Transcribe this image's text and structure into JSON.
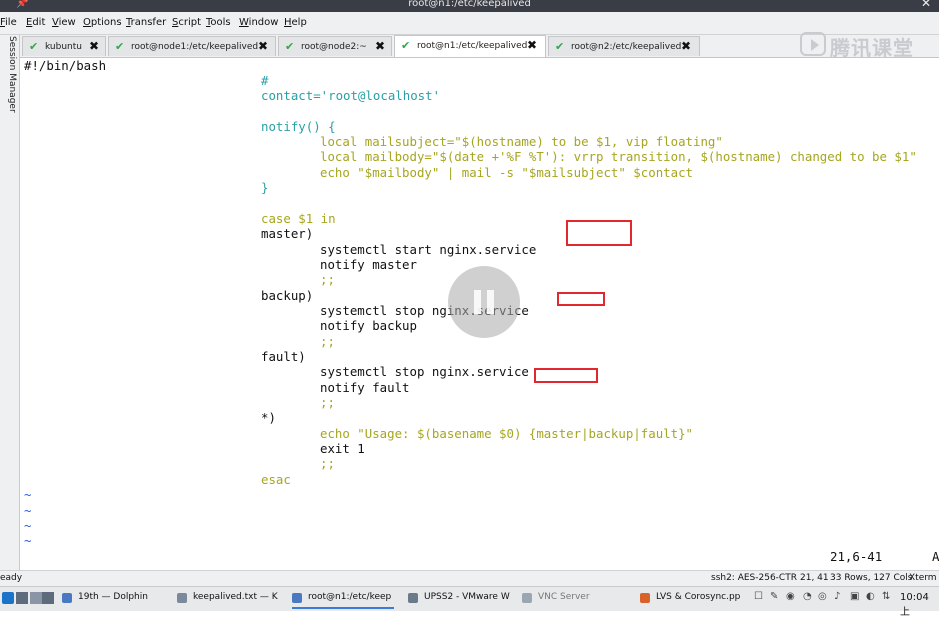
{
  "window": {
    "title": "root@n1:/etc/keepalived"
  },
  "menu": [
    {
      "label": "File",
      "acc": "F",
      "rest": "ile"
    },
    {
      "label": "Edit",
      "acc": "E",
      "rest": "dit"
    },
    {
      "label": "View",
      "acc": "V",
      "rest": "iew"
    },
    {
      "label": "Options",
      "acc": "O",
      "rest": "ptions"
    },
    {
      "label": "Transfer",
      "acc": "T",
      "rest": "ransfer"
    },
    {
      "label": "Script",
      "acc": "S",
      "rest": "cript"
    },
    {
      "label": "Tools",
      "acc": "T",
      "rest": "ools"
    },
    {
      "label": "Window",
      "acc": "W",
      "rest": "indow"
    },
    {
      "label": "Help",
      "acc": "H",
      "rest": "elp"
    }
  ],
  "side_panel": {
    "label": "Session Manager"
  },
  "tabs": [
    {
      "label": "kubuntu"
    },
    {
      "label": "root@node1:/etc/keepalived"
    },
    {
      "label": "root@node2:~"
    },
    {
      "label": "root@n1:/etc/keepalived"
    },
    {
      "label": "root@n2:/etc/keepalived"
    }
  ],
  "watermark": "腾讯课堂",
  "editor": {
    "lines": [
      "#!/bin/bash",
      "#",
      "contact='root@localhost'",
      "notify() {",
      "local mailsubject=\"$(hostname) to be $1, vip floating\"",
      "local mailbody=\"$(date +'%F %T'): vrrp transition, $(hostname) changed to be $1\"",
      "echo \"$mailbody\" | mail -s \"$mailsubject\" $contact",
      "}",
      "case $1 in",
      "master)",
      "systemctl start nginx.service",
      "notify master",
      ";;",
      "backup)",
      "systemctl stop nginx.service",
      "notify backup",
      ";;",
      "fault)",
      "systemctl stop nginx.service",
      "notify fault",
      ";;",
      "*)",
      "echo \"Usage: $(basename $0) {master|backup|fault}\"",
      "exit 1",
      ";;",
      "esac"
    ],
    "tilde": "~",
    "cursor_position": "21,6-41",
    "scroll_indicator": "A"
  },
  "status": {
    "left": "eady",
    "ssh": "ssh2: AES-256-CTR",
    "cursor": "21, 41",
    "size": "33 Rows, 127 Cols",
    "term": "Xterm"
  },
  "taskbar": {
    "tasks": [
      {
        "label": "19th — Dolphin"
      },
      {
        "label": "keepalived.txt — K"
      },
      {
        "label": "root@n1:/etc/keep"
      },
      {
        "label": "UPSS2 - VMware W"
      },
      {
        "label": "VNC Server"
      },
      {
        "label": "LVS & Corosync.pp"
      }
    ],
    "clock": "10:04 上"
  },
  "colors": {
    "keyword": "#a6a620",
    "identifier": "#2aa0a6",
    "string": "#c71585",
    "highlight_box": "#e0282e"
  }
}
